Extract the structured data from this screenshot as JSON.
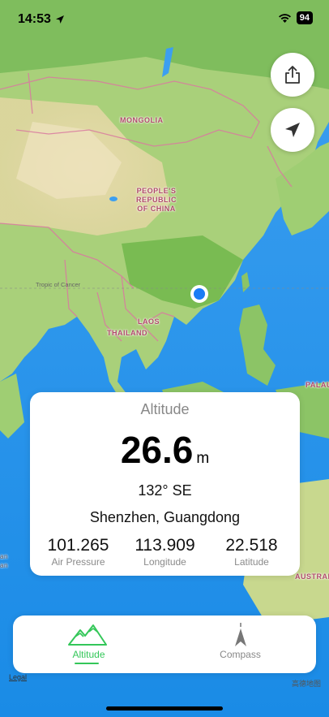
{
  "status": {
    "time": "14:53",
    "battery": "94"
  },
  "map": {
    "labels": {
      "mongolia": "MONGOLIA",
      "china": "PEOPLE'S\nREPUBLIC\nOF CHINA",
      "laos": "LAOS",
      "thailand": "THAILAND",
      "palau": "PALAU",
      "australia": "AUSTRAL",
      "tropic": "Tropic of Cancer",
      "edge_left": "an\nan"
    },
    "legal": "Legal",
    "provider": "高德地图"
  },
  "card": {
    "title": "Altitude",
    "altitude_value": "26.6",
    "altitude_unit": "m",
    "heading": "132° SE",
    "place": "Shenzhen, Guangdong",
    "metrics": [
      {
        "value": "101.265",
        "label": "Air Pressure"
      },
      {
        "value": "113.909",
        "label": "Longitude"
      },
      {
        "value": "22.518",
        "label": "Latitude"
      }
    ]
  },
  "tabs": [
    {
      "label": "Altitude",
      "icon": "mountain-icon",
      "selected": true
    },
    {
      "label": "Compass",
      "icon": "compass-needle-icon",
      "selected": false
    }
  ],
  "colors": {
    "accent": "#34c759",
    "location": "#1a7cf5",
    "border": "#d97aa0"
  }
}
